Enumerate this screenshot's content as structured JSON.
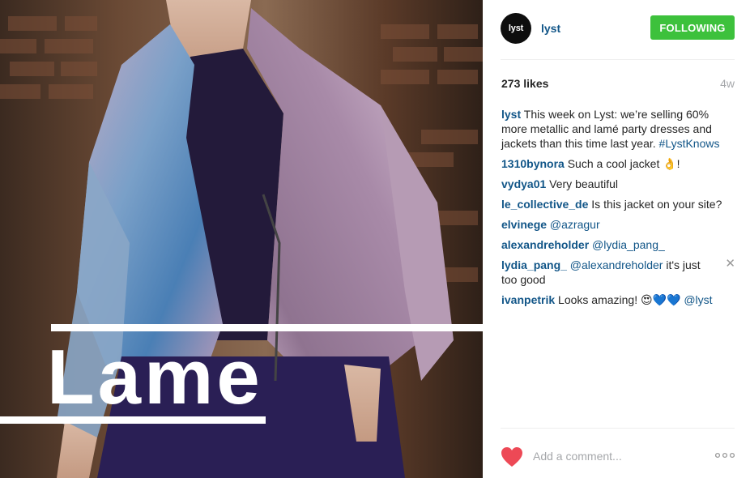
{
  "photo": {
    "overlay_text": "Lame"
  },
  "header": {
    "avatar_text": "lyst",
    "username": "lyst",
    "follow_label": "FOLLOWING"
  },
  "stats": {
    "likes": "273 likes",
    "age": "4w"
  },
  "comments": [
    {
      "user": "lyst",
      "text": " This week on Lyst: we’re selling 60% more metallic and lamé party dresses and jackets than this time last year. ",
      "hashtag": "#LystKnows"
    },
    {
      "user": "1310bynora",
      "text": " Such a cool jacket 👌!"
    },
    {
      "user": "vydya01",
      "text": " Very beautiful"
    },
    {
      "user": "le_collective_de",
      "text": " Is this jacket on your site?"
    },
    {
      "user": "elvinege",
      "mention": " @azragur"
    },
    {
      "user": "alexandreholder",
      "mention": " @lydia_pang_"
    },
    {
      "user": "lydia_pang_",
      "mention": " @alexandreholder",
      "text": " it's just too good"
    },
    {
      "user": "ivanpetrik",
      "text": " Looks amazing! 😍💙💙 ",
      "mention": "@lyst"
    }
  ],
  "footer": {
    "comment_placeholder": "Add a comment..."
  },
  "colors": {
    "link_blue": "#125688",
    "follow_green": "#3dc13c",
    "heart_red": "#ed4956",
    "muted_gray": "#a5a7aa"
  },
  "icons": [
    "heart-icon",
    "more-options-icon",
    "close-icon"
  ]
}
